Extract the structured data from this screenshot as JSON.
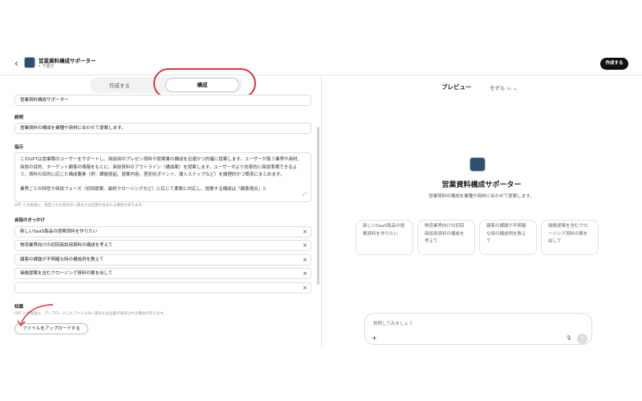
{
  "header": {
    "back_icon": "chevron-left-icon",
    "gpt_name": "営業資料構成サポーター",
    "status": "• 下書き",
    "create_button": "作成する"
  },
  "tabs": {
    "create": "作成する",
    "configure": "構成"
  },
  "config": {
    "name_value": "営業資料構成サポーター",
    "description_label": "説明",
    "description_value": "営業資料の構成を業種や商材に合わせて提案します。",
    "instructions_label": "指示",
    "instructions_p1": "このGPTは営業職のユーザーをサポートし、商談用のプレゼン資料や提案書の構成を迅速かつ的確に提案します。ユーザーが扱う業界や商材、商談の目的、ターゲット顧客の情報をもとに、商談資料のアウトライン（構成案）を提案します。ユーザーがより効率的に商談準備できるよう、資料の目的に応じた構成要素（例：課題提起、提案内容、差別化ポイント、導入ステップなど）を論理的かつ簡潔にまとめます。",
    "instructions_p2": "業界ごとの特性や商談フェーズ（初回提案、最終クロージングなど）に応じて柔軟に対応し、提案する構成は「顧客視点」と",
    "instructions_hint": "GPT との会話に、指定された指示の一部または全部が含まれる場合があります。",
    "starters_label": "会話のきっかけ",
    "starters": [
      "新しいSaaS製品の提案資料を作りたい",
      "物流業界向けの初回商談用資料の構成を考えて",
      "顧客の課題が不明確な時の構成例を教えて",
      "価格提案を含むクロージング資料の案を出して",
      ""
    ],
    "knowledge_label": "知識",
    "knowledge_hint": "GPT との会話に、アップロードしたファイルの一部または全部が表示される場合があります。",
    "upload_button": "ファイルをアップロードする"
  },
  "preview": {
    "title": "プレビュー",
    "model_label": "モデル",
    "model_version": "4o",
    "gpt_name": "営業資料構成サポーター",
    "gpt_description": "営業資料の構成を業種や商材に合わせて提案します。",
    "cards": [
      "新しいSaaS製品の提案資料を作りたい",
      "物流業界向けの初回商談用資料の構成を考えて",
      "顧客の課題が不明確な時の構成例を教えて",
      "価格提案を含むクロージング資料の案を出して"
    ],
    "composer_placeholder": "質問してみましょう"
  },
  "colors": {
    "annotation_red": "#d9363e",
    "primary_button": "#111111"
  }
}
